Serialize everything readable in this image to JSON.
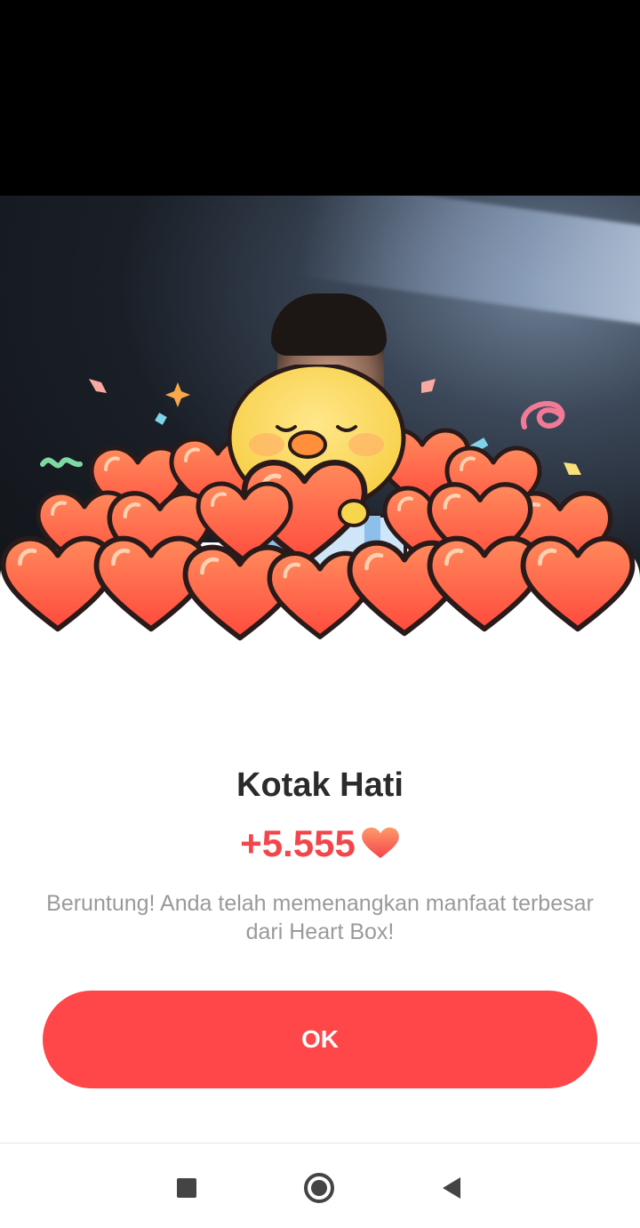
{
  "dialog": {
    "title": "Kotak Hati",
    "amount": "+5.555",
    "amount_icon": "heart-icon",
    "message": "Beruntung! Anda telah memenangkan manfaat terbesar dari Heart Box!",
    "ok_label": "OK"
  },
  "nav_bar": {
    "items": [
      "recent-apps-icon",
      "home-icon",
      "back-icon"
    ]
  },
  "colors": {
    "accent": "#ff4649",
    "amount": "#f3454a",
    "title": "#2b2b2b",
    "message": "#9a9a9a"
  }
}
